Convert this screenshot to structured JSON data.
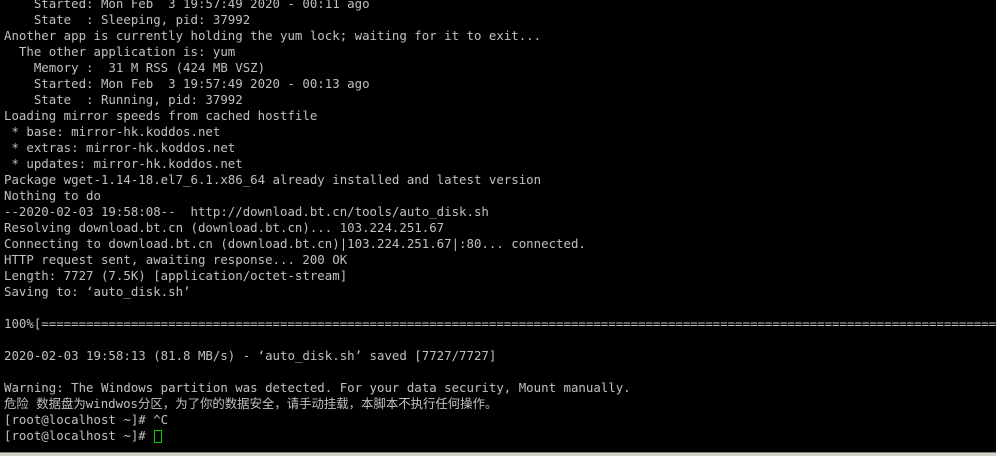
{
  "terminal": {
    "lines": [
      "    Started: Mon Feb  3 19:57:49 2020 - 00:11 ago",
      "    State  : Sleeping, pid: 37992",
      "Another app is currently holding the yum lock; waiting for it to exit...",
      "  The other application is: yum",
      "    Memory :  31 M RSS (424 MB VSZ)",
      "    Started: Mon Feb  3 19:57:49 2020 - 00:13 ago",
      "    State  : Running, pid: 37992",
      "Loading mirror speeds from cached hostfile",
      " * base: mirror-hk.koddos.net",
      " * extras: mirror-hk.koddos.net",
      " * updates: mirror-hk.koddos.net",
      "Package wget-1.14-18.el7_6.1.x86_64 already installed and latest version",
      "Nothing to do",
      "--2020-02-03 19:58:08--  http://download.bt.cn/tools/auto_disk.sh",
      "Resolving download.bt.cn (download.bt.cn)... 103.224.251.67",
      "Connecting to download.bt.cn (download.bt.cn)|103.224.251.67|:80... connected.",
      "HTTP request sent, awaiting response... 200 OK",
      "Length: 7727 (7.5K) [application/octet-stream]",
      "Saving to: ‘auto_disk.sh’",
      "",
      "100%[=====================================================================================================================================>]",
      "",
      "2020-02-03 19:58:13 (81.8 MB/s) - ‘auto_disk.sh’ saved [7727/7727]",
      "",
      "Warning: The Windows partition was detected. For your data security, Mount manually.",
      "危险 数据盘为windwos分区，为了你的数据安全，请手动挂载，本脚本不执行任何操作。",
      "[root@localhost ~]# ^C"
    ],
    "prompt": "[root@localhost ~]# ",
    "colors": {
      "background": "#000000",
      "text": "#c0c0c0",
      "cursor": "#00d000"
    }
  }
}
